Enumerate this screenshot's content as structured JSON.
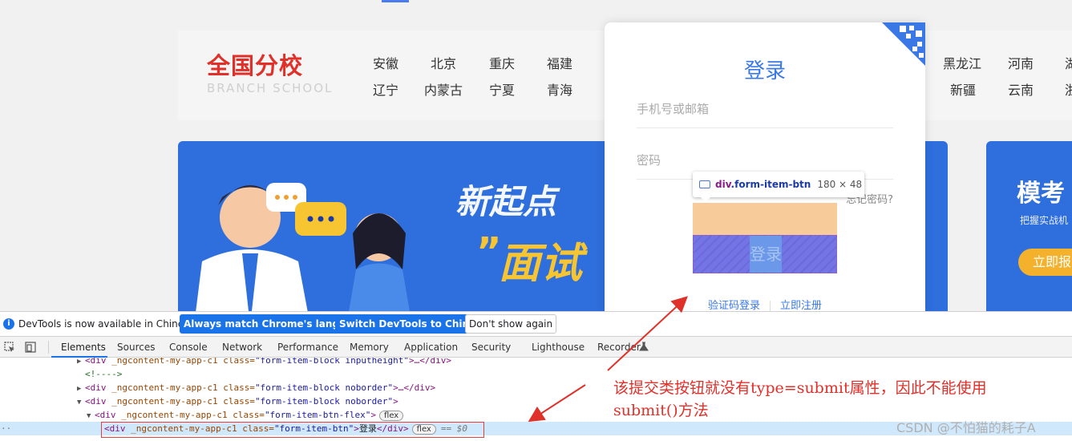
{
  "page": {
    "logo_main": "全国分校",
    "logo_sub": "BRANCH SCHOOL",
    "cities_row1": [
      "安徽",
      "北京",
      "重庆",
      "福建",
      "黑龙江",
      "河南",
      "湖"
    ],
    "cities_row2": [
      "辽宁",
      "内蒙古",
      "宁夏",
      "青海",
      "新疆",
      "云南",
      "浙"
    ],
    "banner_slogan1": "新起点",
    "banner_slogan2": "面试",
    "banner_quote": "”",
    "side_banner_title": "模考",
    "side_banner_sub": "把握实战机",
    "side_banner_button": "立即报"
  },
  "login": {
    "title": "登录",
    "phone_placeholder": "手机号或邮箱",
    "password_placeholder": "密码",
    "forgot_password": "忘记密码?",
    "submit_label": "登录",
    "sms_login": "验证码登录",
    "register": "立即注册"
  },
  "tooltip": {
    "tag": "div",
    "class_name": ".form-item-btn",
    "size": "180 × 48"
  },
  "devtools": {
    "info_text": "DevTools is now available in Chinese!",
    "btn_match": "Always match Chrome's language",
    "btn_switch": "Switch DevTools to Chinese",
    "btn_dismiss": "Don't show again",
    "tabs": [
      "Elements",
      "Sources",
      "Console",
      "Network",
      "Performance",
      "Memory",
      "Application",
      "Security",
      "Lighthouse",
      "Recorder"
    ],
    "active_tab": "Elements",
    "lines": {
      "l1_attr": "_ngcontent-my-app-c1 class=",
      "l1_val": "\"form-item-block inputheight\"",
      "l1_tail": ">…</",
      "l2_comment": "<!---->",
      "l3_attr": "_ngcontent-my-app-c1 class=",
      "l3_val": "\"form-item-block  noborder\"",
      "l3_tail": ">…</",
      "l4_attr": "_ngcontent-my-app-c1 class=",
      "l4_val": "\"form-item-block noborder\"",
      "l5_attr": "_ngcontent-my-app-c1 class=",
      "l5_val": "\"form-item-btn-flex\"",
      "l6_attr": "_ngcontent-my-app-c1 class=",
      "l6_val": "\"form-item-btn\"",
      "l6_text": "登录",
      "flex_badge": "flex",
      "dollar": "== $0",
      "tag_div": "div"
    }
  },
  "annotation": {
    "text": "该提交类按钮就没有type=submit属性，因此不能使用submit()方法",
    "color": "#e0302a"
  },
  "watermark": "CSDN @不怕猫的耗子A"
}
